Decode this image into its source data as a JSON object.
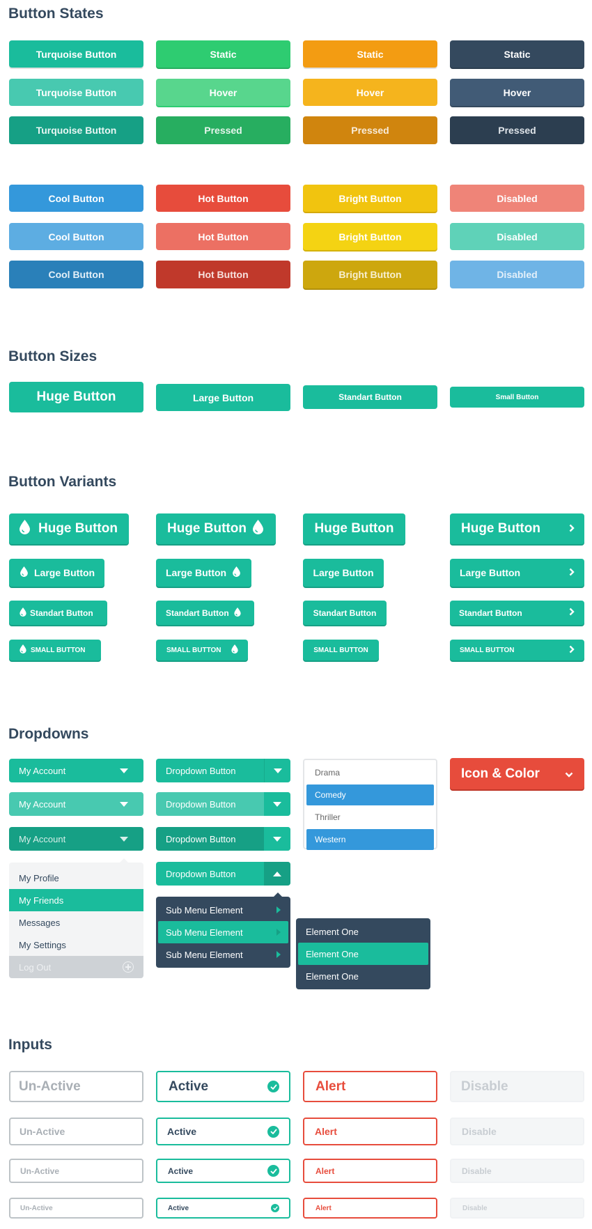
{
  "colors": {
    "turquoise": "#1abc9c",
    "turquoise_hover": "#48c9b0",
    "turquoise_pressed": "#16a085",
    "emerald": "#2ecc71",
    "emerald_hover": "#58d68d",
    "emerald_pressed": "#27ae60",
    "orange": "#f39c12",
    "orange_hover": "#f5b41d",
    "orange_pressed": "#d0850e",
    "navy": "#34495e",
    "navy_hover": "#415b76",
    "navy_pressed": "#2c3e50",
    "cool": "#3498db",
    "cool_hover": "#5dade2",
    "cool_pressed": "#2a80b9",
    "hot": "#e74c3c",
    "hot_hover": "#ec7063",
    "hot_pressed": "#c0392b",
    "bright": "#f1c40f",
    "bright_hover": "#f4d313",
    "bright_pressed": "#cda70e",
    "disabled_red": "#ef8478",
    "disabled_green": "#5fd2b8",
    "disabled_blue": "#6fb4e6"
  },
  "sections": {
    "states": "Button States",
    "sizes": "Button Sizes",
    "variants": "Button Variants",
    "dropdowns": "Dropdowns",
    "inputs": "Inputs"
  },
  "states": {
    "rows_a": [
      [
        "Turquoise Button",
        "Static",
        "Static",
        "Static"
      ],
      [
        "Turquoise Button",
        "Hover",
        "Hover",
        "Hover"
      ],
      [
        "Turquoise Button",
        "Pressed",
        "Pressed",
        "Pressed"
      ]
    ],
    "rows_b": [
      [
        "Cool Button",
        "Hot Button",
        "Bright Button",
        "Disabled"
      ],
      [
        "Cool Button",
        "Hot Button",
        "Bright Button",
        "Disabled"
      ],
      [
        "Cool Button",
        "Hot Button",
        "Bright Button",
        "Disabled"
      ]
    ]
  },
  "sizes": [
    "Huge Button",
    "Large Button",
    "Standart Button",
    "Small Button"
  ],
  "variants": {
    "huge": "Huge Button",
    "large": "Large Button",
    "standard": "Standart Button",
    "small": "SMALL BUTTON",
    "icon_left": "drop-icon",
    "icon_right": "chevron-right-icon"
  },
  "dropdowns": {
    "account_label": "My Account",
    "split_label": "Dropdown Button",
    "menu_items": [
      "My Profile",
      "My Friends",
      "Messages",
      "My Settings"
    ],
    "menu_selected": "My Friends",
    "logout_label": "Log Out",
    "submenu_items": [
      "Sub Menu Element",
      "Sub Menu Element",
      "Sub Menu Element"
    ],
    "element_items": [
      "Element One",
      "Element One",
      "Element One"
    ],
    "list_options": [
      "Drama",
      "Comedy",
      "Thriller",
      "Western"
    ],
    "list_selected": [
      "Comedy",
      "Western"
    ],
    "icon_color_label": "Icon & Color"
  },
  "inputs": {
    "unactive": "Un-Active",
    "active": "Active",
    "alert": "Alert",
    "disable": "Disable"
  }
}
